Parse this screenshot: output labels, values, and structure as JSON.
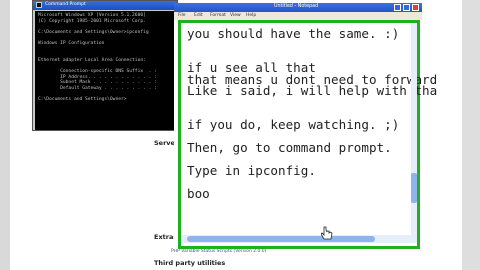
{
  "background_page": {
    "server_label": "Server",
    "extras_label": "Extras",
    "link_text": "PHP Variable Status Scripts (Version 2.0.0)",
    "third_party_label": "Third party utilities"
  },
  "cmd_window": {
    "title": "Command Prompt",
    "lines": [
      "Microsoft Windows XP [Version 5.1.2600]",
      "(C) Copyright 1985-2001 Microsoft Corp.",
      "",
      "C:\\Documents and Settings\\Owner>ipconfig",
      "",
      "Windows IP Configuration",
      "",
      "",
      "Ethernet adapter Local Area Connection:",
      "",
      "        Connection-specific DNS Suffix  . :",
      "        IP Address. . . . . . . . . . . . :",
      "        Subnet Mask . . . . . . . . . . . :",
      "        Default Gateway . . . . . . . . . :",
      "",
      "C:\\Documents and Settings\\Owner>"
    ]
  },
  "notepad": {
    "title": "Untitled - Notepad",
    "menu": [
      "File",
      "Edit",
      "Format",
      "View",
      "Help"
    ],
    "lines": [
      "you should have the same. :)",
      "",
      "",
      "if u see all that",
      "that means u dont need to forward",
      "Like i said, i will help with tha",
      "",
      "",
      "if you do, keep watching. ;)",
      "",
      "Then, go to command prompt.",
      "",
      "Type in ipconfig.",
      "",
      "boo"
    ]
  }
}
